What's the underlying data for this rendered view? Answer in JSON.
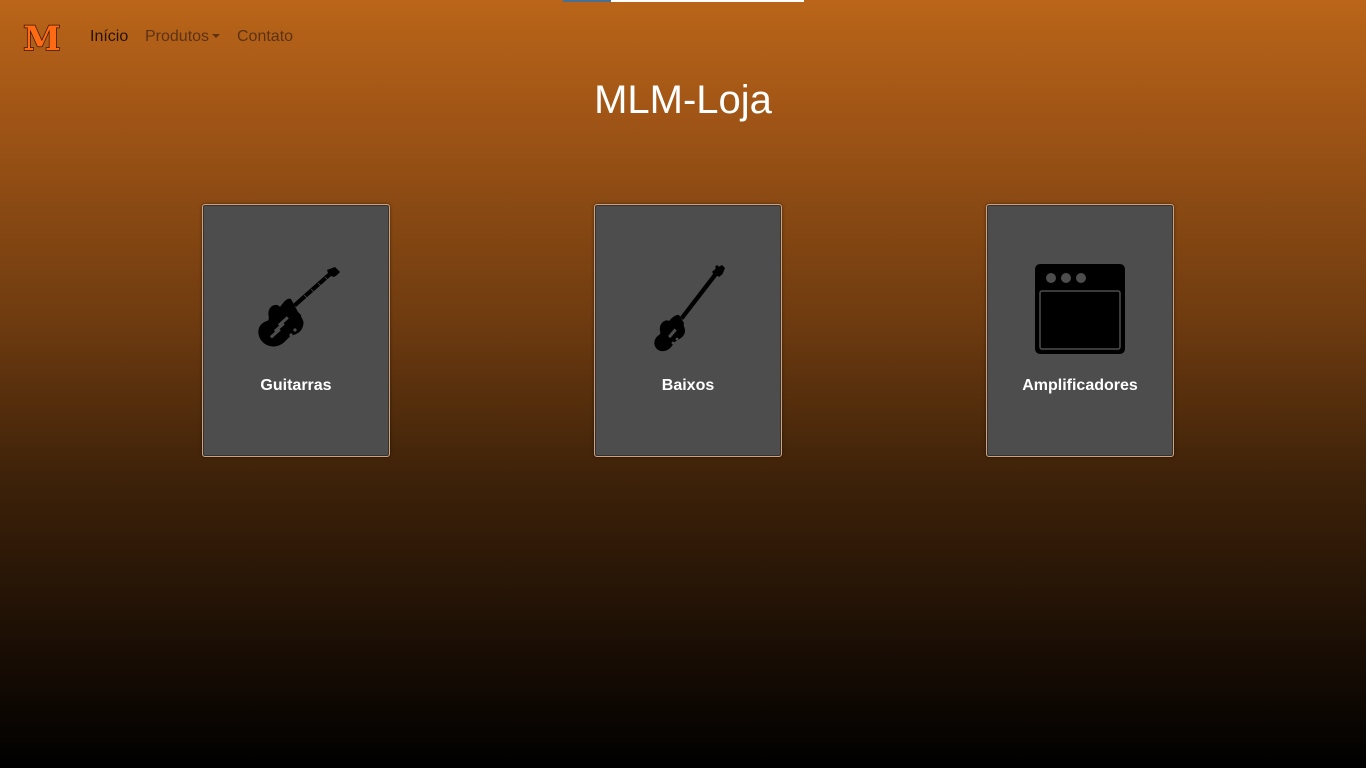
{
  "brand": {
    "logo_text": "M",
    "logo_color": "#ff6a13",
    "logo_icon": "brand-m-logo"
  },
  "nav": {
    "items": [
      {
        "label": "Início",
        "active": true
      },
      {
        "label": "Produtos",
        "has_dropdown": true
      },
      {
        "label": "Contato"
      }
    ]
  },
  "page": {
    "title": "MLM-Loja"
  },
  "categories": [
    {
      "label": "Guitarras",
      "icon": "electric-guitar-icon"
    },
    {
      "label": "Baixos",
      "icon": "bass-guitar-icon"
    },
    {
      "label": "Amplificadores",
      "icon": "amplifier-icon"
    }
  ],
  "colors": {
    "background_top": "#ba6519",
    "background_bottom": "#000000",
    "card_background": "#4d4d4d",
    "card_border": "#d2a27c",
    "text_light": "#ffffff",
    "nav_text": "#5c3213",
    "nav_active_text": "#241208"
  }
}
